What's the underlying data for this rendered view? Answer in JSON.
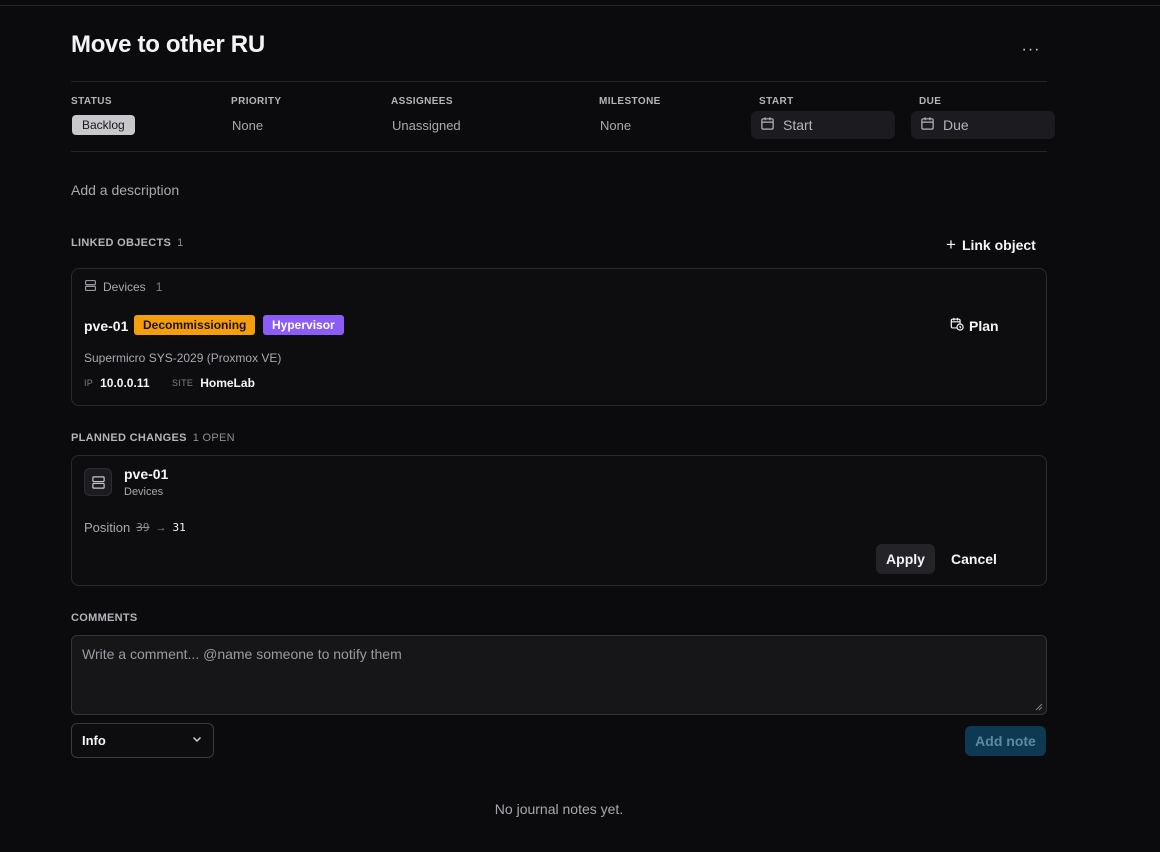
{
  "issue": {
    "title": "Move to other RU",
    "more_label": "···"
  },
  "meta": {
    "status": {
      "label": "STATUS",
      "value": "Backlog"
    },
    "priority": {
      "label": "PRIORITY",
      "value": "None"
    },
    "assignees": {
      "label": "ASSIGNEES",
      "value": "Unassigned"
    },
    "milestone": {
      "label": "MILESTONE",
      "value": "None"
    },
    "start": {
      "label": "START",
      "value": "Start",
      "icon": "calendar-icon"
    },
    "due": {
      "label": "DUE",
      "value": "Due",
      "icon": "calendar-icon"
    }
  },
  "description": {
    "placeholder": "Add a description"
  },
  "linked": {
    "label": "LINKED OBJECTS",
    "count": "1",
    "link_button": "Link object",
    "group": {
      "label": "Devices",
      "count": "1"
    },
    "device": {
      "name": "pve-01",
      "tags": [
        {
          "text": "Decommissioning",
          "color": "#f59e0b"
        },
        {
          "text": "Hypervisor",
          "color": "#8b5cf6"
        }
      ],
      "plan_label": "Plan",
      "description": "Supermicro SYS-2029 (Proxmox VE)",
      "ip_key": "IP",
      "ip_value": "10.0.0.11",
      "site_key": "SITE",
      "site_value": "HomeLab"
    }
  },
  "planned": {
    "label": "PLANNED CHANGES",
    "count": "1 OPEN",
    "change": {
      "name": "pve-01",
      "type": "Devices",
      "field": "Position",
      "old": "39",
      "new": "31",
      "apply_label": "Apply",
      "cancel_label": "Cancel"
    }
  },
  "comments": {
    "label": "COMMENTS",
    "placeholder": "Write a comment... @name someone to notify them",
    "type_select": "Info",
    "add_label": "Add note",
    "empty": "No journal notes yet."
  },
  "colors": {
    "background": "#0b0b0d",
    "accent_disabled": "#0d3a52"
  }
}
